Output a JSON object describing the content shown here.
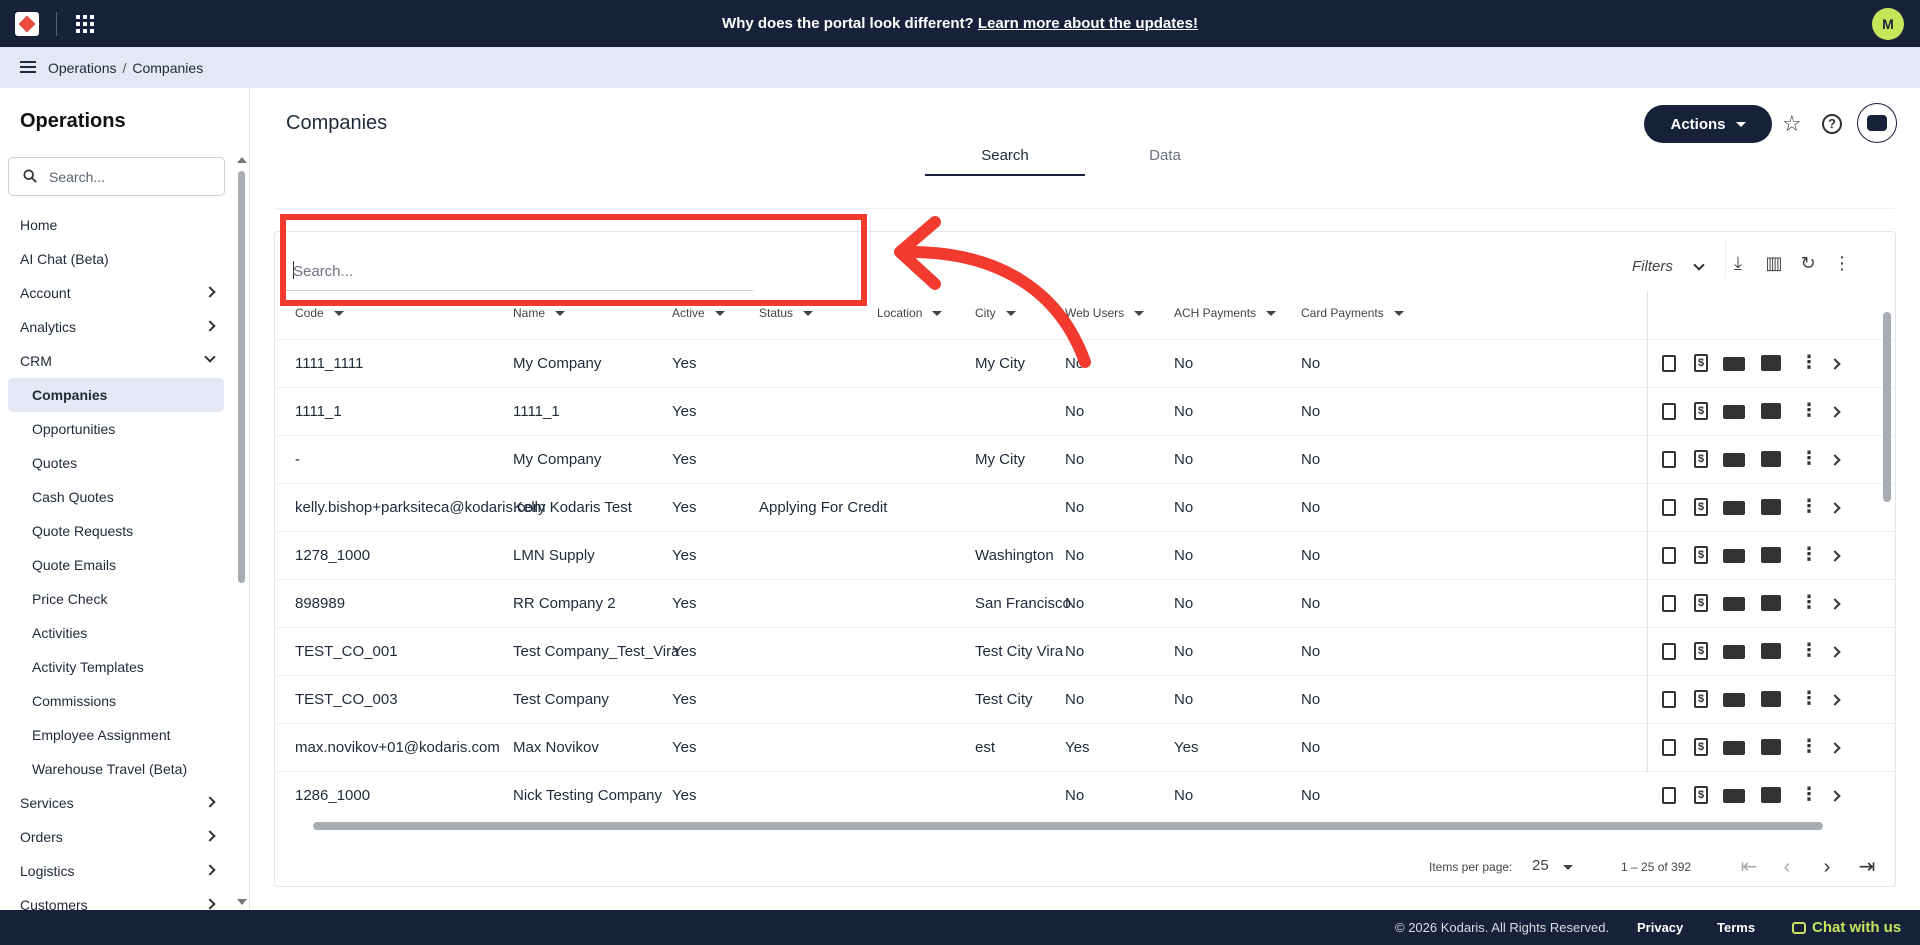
{
  "topbar": {
    "announcement_prefix": "Why does the portal look different?",
    "announcement_link": "Learn more about the updates!",
    "avatar_initial": "M"
  },
  "breadcrumb": {
    "level1": "Operations",
    "separator": "/",
    "level2": "Companies"
  },
  "sidebar": {
    "title": "Operations",
    "search_placeholder": "Search...",
    "items": [
      {
        "label": "Home",
        "type": "item"
      },
      {
        "label": "AI Chat (Beta)",
        "type": "item"
      },
      {
        "label": "Account",
        "type": "group"
      },
      {
        "label": "Analytics",
        "type": "group"
      },
      {
        "label": "CRM",
        "type": "group-open"
      },
      {
        "label": "Companies",
        "type": "sub-active"
      },
      {
        "label": "Opportunities",
        "type": "sub"
      },
      {
        "label": "Quotes",
        "type": "sub"
      },
      {
        "label": "Cash Quotes",
        "type": "sub"
      },
      {
        "label": "Quote Requests",
        "type": "sub"
      },
      {
        "label": "Quote Emails",
        "type": "sub"
      },
      {
        "label": "Price Check",
        "type": "sub"
      },
      {
        "label": "Activities",
        "type": "sub"
      },
      {
        "label": "Activity Templates",
        "type": "sub"
      },
      {
        "label": "Commissions",
        "type": "sub"
      },
      {
        "label": "Employee Assignment",
        "type": "sub"
      },
      {
        "label": "Warehouse Travel (Beta)",
        "type": "sub"
      },
      {
        "label": "Services",
        "type": "group"
      },
      {
        "label": "Orders",
        "type": "group"
      },
      {
        "label": "Logistics",
        "type": "group"
      },
      {
        "label": "Customers",
        "type": "group"
      }
    ]
  },
  "page": {
    "title": "Companies",
    "actions_label": "Actions",
    "tabs": [
      "Search",
      "Data"
    ],
    "search_placeholder": "Search...",
    "filters_label": "Filters"
  },
  "table": {
    "columns": [
      "Code",
      "Name",
      "Active",
      "Status",
      "Location",
      "City",
      "Web Users",
      "ACH Payments",
      "Card Payments"
    ],
    "rows": [
      [
        "1111_1111",
        "My Company",
        "Yes",
        "",
        "",
        "My City",
        "No",
        "No",
        "No"
      ],
      [
        "1111_1",
        "1111_1",
        "Yes",
        "",
        "",
        "",
        "No",
        "No",
        "No"
      ],
      [
        "-",
        "My Company",
        "Yes",
        "",
        "",
        "My City",
        "No",
        "No",
        "No"
      ],
      [
        "kelly.bishop+parksiteca@kodaris.com",
        "Kelly Kodaris Test",
        "Yes",
        "Applying For Credit",
        "",
        "",
        "No",
        "No",
        "No"
      ],
      [
        "1278_1000",
        "LMN Supply",
        "Yes",
        "",
        "",
        "Washington",
        "No",
        "No",
        "No"
      ],
      [
        "898989",
        "RR Company 2",
        "Yes",
        "",
        "",
        "San Francisco",
        "No",
        "No",
        "No"
      ],
      [
        "TEST_CO_001",
        "Test Company_Test_Vira",
        "Yes",
        "",
        "",
        "Test City Vira",
        "No",
        "No",
        "No"
      ],
      [
        "TEST_CO_003",
        "Test Company",
        "Yes",
        "",
        "",
        "Test City",
        "No",
        "No",
        "No"
      ],
      [
        "max.novikov+01@kodaris.com",
        "Max Novikov",
        "Yes",
        "",
        "",
        "est",
        "Yes",
        "Yes",
        "No"
      ],
      [
        "1286_1000",
        "Nick Testing Company",
        "Yes",
        "",
        "",
        "",
        "No",
        "No",
        "No"
      ]
    ]
  },
  "pagination": {
    "items_per_page_label": "Items per page:",
    "items_per_page": "25",
    "range": "1 – 25 of 392"
  },
  "footer": {
    "copyright": "© 2026 Kodaris. All Rights Reserved.",
    "privacy": "Privacy",
    "terms": "Terms",
    "chat": "Chat with us"
  },
  "colors": {
    "navy": "#17213a",
    "accent_lime": "#c6e65a",
    "annotation_red": "#f23a2f",
    "breadcrumb_bg": "#e3e8f4"
  }
}
